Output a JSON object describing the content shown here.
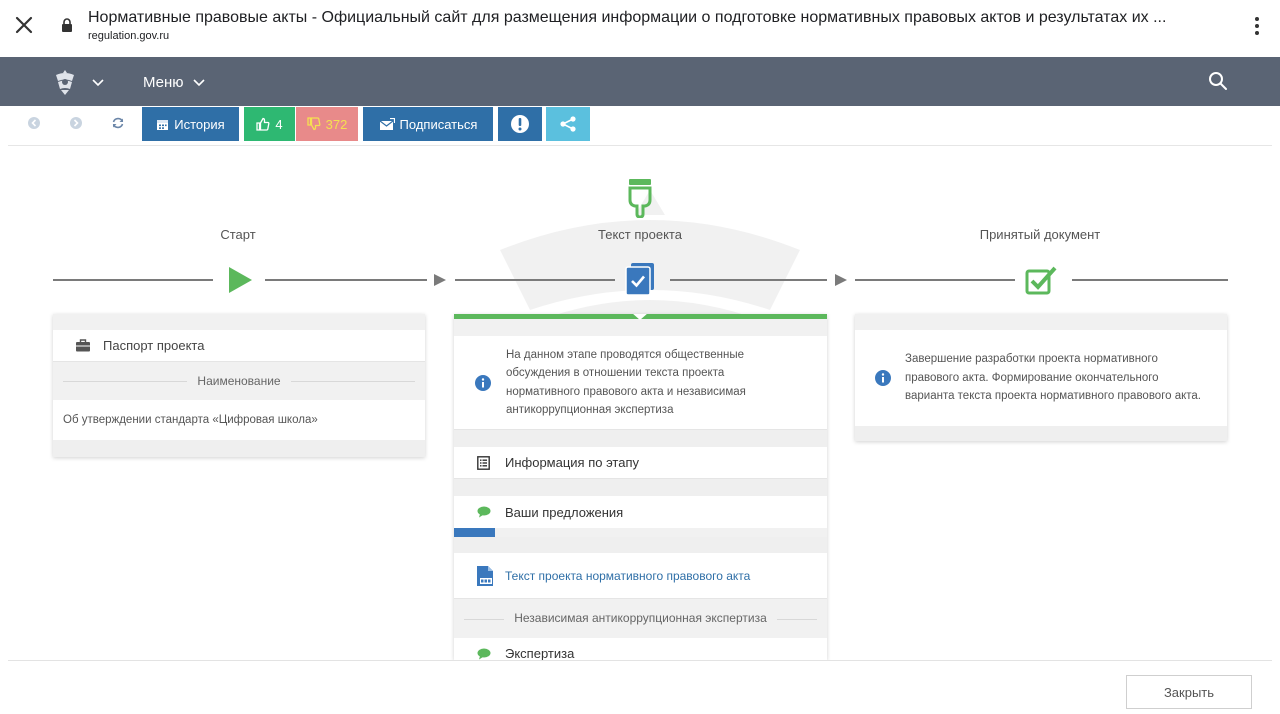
{
  "browser": {
    "title": "Нормативные правовые акты - Официальный сайт для размещения информации о подготовке нормативных правовых актов и результатах их ...",
    "url": "regulation.gov.ru"
  },
  "header": {
    "menu_label": "Меню"
  },
  "toolbar": {
    "history_label": "История",
    "likes_count": "4",
    "dislikes_count": "372",
    "subscribe_label": "Подписаться"
  },
  "stepper": {
    "steps": [
      {
        "label": "Старт"
      },
      {
        "label": "Текст проекта"
      },
      {
        "label": "Принятый документ"
      }
    ]
  },
  "left_card": {
    "passport_label": "Паспорт проекта",
    "name_header": "Наименование",
    "name_value": "Об утверждении стандарта «Цифровая школа»"
  },
  "middle_card": {
    "info_text": "На данном этапе проводятся общественные обсуждения в отношении текста проекта нормативного правового акта и независимая антикоррупционная экспертиза",
    "stage_info_label": "Информация по этапу",
    "proposals_label": "Ваши предложения",
    "progress_fraction": 0.11,
    "project_text_link": "Текст проекта нормативного правового акта",
    "expertise_header": "Независимая антикоррупционная экспертиза",
    "expertise_label": "Экспертиза"
  },
  "right_card": {
    "info_text": "Завершение разработки проекта нормативного правового акта. Формирование окончательного варианта текста проекта нормативного правового акта."
  },
  "footer": {
    "close_label": "Закрыть"
  },
  "colors": {
    "header_bg": "#5a6474",
    "history": "#2f6fa7",
    "like": "#2eb872",
    "dislike": "#e88a8a",
    "dislike_text": "#f5e050",
    "subscribe": "#2f6fa7",
    "alert": "#2f6fa7",
    "share": "#5bc0de",
    "green": "#5cb85c",
    "blue": "#3a78bd"
  }
}
